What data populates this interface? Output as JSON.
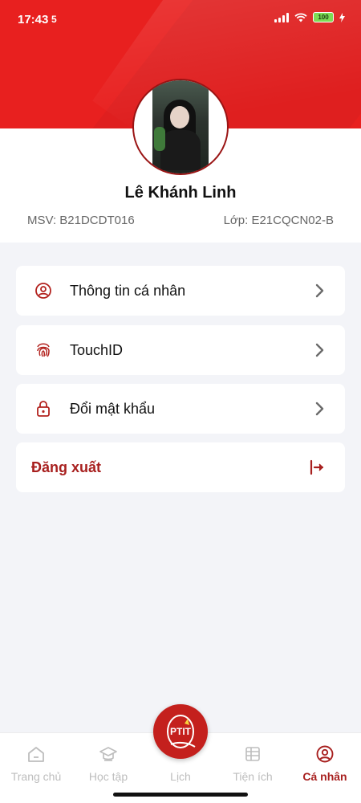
{
  "status_bar": {
    "time": "17:43",
    "sim_indicator": "5",
    "battery": "100"
  },
  "profile": {
    "name": "Lê Khánh Linh",
    "msv": "MSV: B21DCDT016",
    "class": "Lớp: E21CQCN02-B"
  },
  "menu": {
    "items": [
      {
        "label": "Thông tin cá nhân",
        "icon": "user-circle-icon"
      },
      {
        "label": "TouchID",
        "icon": "fingerprint-icon"
      },
      {
        "label": "Đổi mật khẩu",
        "icon": "lock-icon"
      }
    ],
    "logout_label": "Đăng xuất"
  },
  "bottom_nav": {
    "items": [
      {
        "label": "Trang chủ",
        "icon": "home-icon"
      },
      {
        "label": "Học tập",
        "icon": "graduation-cap-icon"
      },
      {
        "label": "Lịch",
        "icon": "calendar-icon"
      },
      {
        "label": "Tiện ích",
        "icon": "utilities-icon"
      },
      {
        "label": "Cá nhân",
        "icon": "profile-icon"
      }
    ],
    "active_index": 4,
    "fab_logo": "PTIT"
  },
  "colors": {
    "brand_red": "#e8201f",
    "accent_dark_red": "#a8201f",
    "inactive_gray": "#bdbdbd"
  }
}
